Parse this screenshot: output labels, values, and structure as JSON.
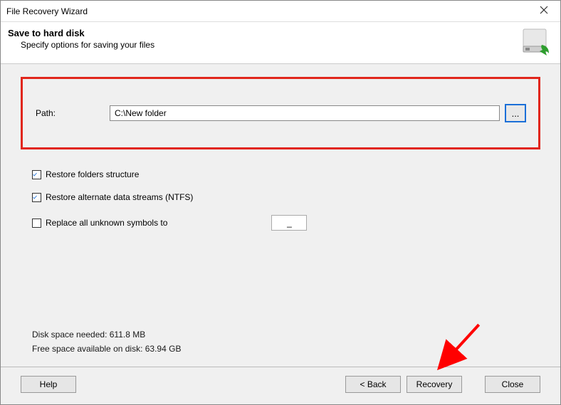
{
  "window": {
    "title": "File Recovery Wizard"
  },
  "header": {
    "heading": "Save to hard disk",
    "sub": "Specify options for saving your files"
  },
  "path": {
    "label": "Path:",
    "value": "C:\\New folder",
    "browse_label": "..."
  },
  "options": {
    "restore_folders": {
      "label": "Restore folders structure",
      "checked": true
    },
    "restore_ads": {
      "label": "Restore alternate data streams (NTFS)",
      "checked": true
    },
    "replace_symbols": {
      "label": "Replace all unknown symbols to",
      "checked": false,
      "value": "_"
    }
  },
  "disk": {
    "needed": "Disk space needed: 611.8 MB",
    "free": "Free space available on disk: 63.94 GB"
  },
  "buttons": {
    "help": "Help",
    "back": "< Back",
    "recovery": "Recovery",
    "close": "Close"
  }
}
